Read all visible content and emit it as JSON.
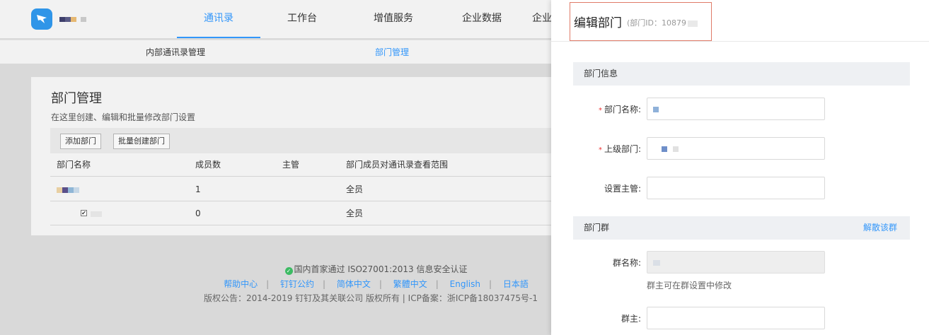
{
  "header": {
    "logo_icon": "dingtalk-logo-icon",
    "nav": [
      {
        "label": "通讯录",
        "active": true
      },
      {
        "label": "工作台",
        "active": false
      },
      {
        "label": "增值服务",
        "active": false
      },
      {
        "label": "企业数据",
        "active": false
      },
      {
        "label": "企业",
        "active": false
      }
    ]
  },
  "subnav": [
    {
      "label": "内部通讯录管理",
      "active": false
    },
    {
      "label": "部门管理",
      "active": true
    }
  ],
  "main": {
    "title": "部门管理",
    "description": "在这里创建、编辑和批量修改部门设置",
    "buttons": {
      "add": "添加部门",
      "batch_create": "批量创建部门"
    },
    "columns": [
      "部门名称",
      "成员数",
      "主管",
      "部门成员对通讯录查看范围"
    ],
    "rows": [
      {
        "members": "1",
        "manager": "",
        "scope": "全员"
      },
      {
        "members": "0",
        "manager": "",
        "scope": "全员"
      }
    ]
  },
  "footer": {
    "certification": "国内首家通过 ISO27001:2013 信息安全认证",
    "links": [
      "帮助中心",
      "钉钉公约",
      "简体中文",
      "繁體中文",
      "English",
      "日本語"
    ],
    "copyright": "版权公告：2014-2019 钉钉及其关联公司 版权所有 | ICP备案：浙ICP备18037475号-1"
  },
  "drawer": {
    "title": "编辑部门",
    "id_text": "(部门ID：10879",
    "section_info": "部门信息",
    "fields": {
      "name_label": "部门名称:",
      "parent_label": "上级部门:",
      "manager_label": "设置主管:"
    },
    "section_group": "部门群",
    "dissolve_label": "解散该群",
    "group_name_label": "群名称:",
    "group_name_hint": "群主可在群设置中修改",
    "group_owner_label": "群主:"
  },
  "colors": {
    "accent": "#3296fa",
    "required": "#e33333",
    "highlight_box": "#e07b68"
  }
}
